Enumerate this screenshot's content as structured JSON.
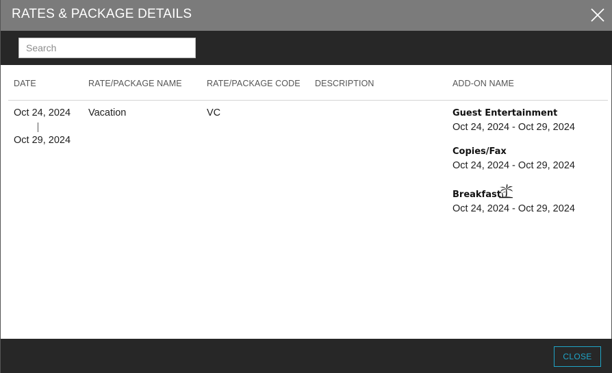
{
  "dialog": {
    "title": "RATES & PACKAGE DETAILS",
    "close_icon": "close-x-icon"
  },
  "search": {
    "placeholder": "Search",
    "value": ""
  },
  "table": {
    "headers": {
      "date": "DATE",
      "name": "RATE/PACKAGE NAME",
      "code": "RATE/PACKAGE CODE",
      "description": "DESCRIPTION",
      "addon": "ADD-ON NAME"
    },
    "row": {
      "date_start": "Oct 24, 2024",
      "date_end": "Oct 29, 2024",
      "name": "Vacation",
      "code": "VC",
      "description": "",
      "addons": [
        {
          "name": "Guest Entertainment",
          "dates": "Oct 24, 2024 - Oct 29, 2024"
        },
        {
          "name": "Copies/Fax",
          "dates": "Oct 24, 2024 - Oct 29, 2024"
        },
        {
          "name": "Breakfast",
          "dates": "Oct 24, 2024 - Oct 29, 2024",
          "icon": "palm-tree-icon"
        }
      ]
    }
  },
  "footer": {
    "close_label": "CLOSE",
    "accent_color": "#1fa5c8"
  },
  "colors": {
    "titlebar": "#7b7b7b",
    "toolbar": "#272727"
  }
}
